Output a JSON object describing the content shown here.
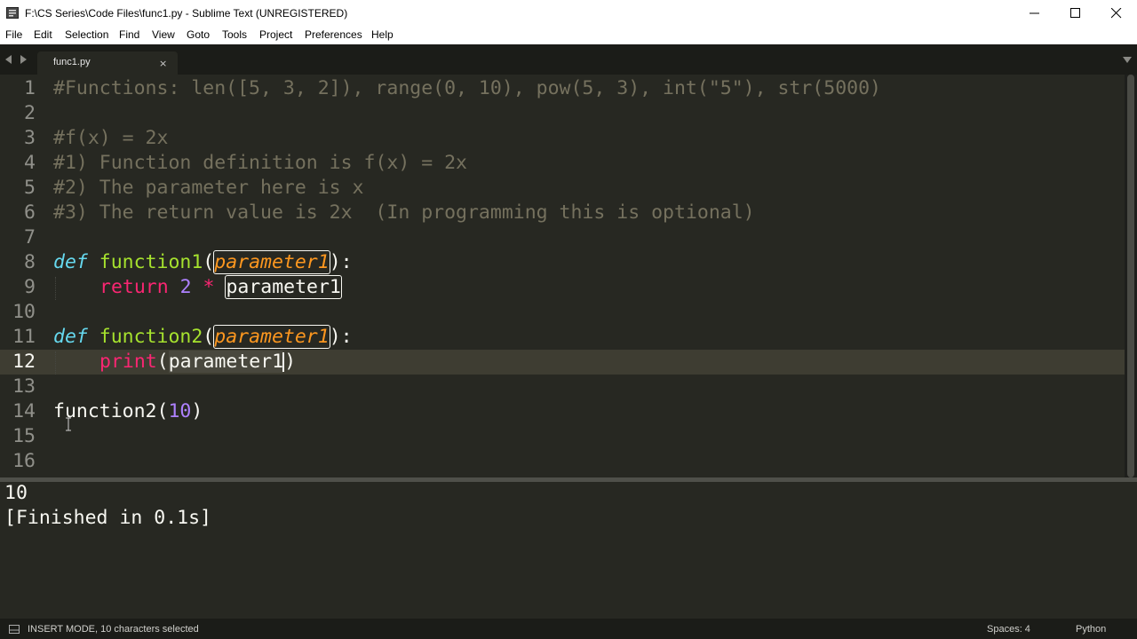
{
  "window": {
    "title": "F:\\CS Series\\Code Files\\func1.py - Sublime Text (UNREGISTERED)",
    "controls": [
      "minimize-icon",
      "maximize-icon",
      "close-icon"
    ]
  },
  "menubar": {
    "items": [
      "File",
      "Edit",
      "Selection",
      "Find",
      "View",
      "Goto",
      "Tools",
      "Project",
      "Preferences",
      "Help"
    ]
  },
  "tabs": {
    "active_tab": "func1.py",
    "close_glyph": "×"
  },
  "editor": {
    "line_numbers": [
      "1",
      "2",
      "3",
      "4",
      "5",
      "6",
      "7",
      "8",
      "9",
      "10",
      "11",
      "12",
      "13",
      "14",
      "15",
      "16"
    ],
    "active_line": 12,
    "code": {
      "l1": "#Functions: len([5, 3, 2]), range(0, 10), pow(5, 3), int(\"5\"), str(5000)",
      "l3": "#f(x) = 2x",
      "l4": "#1) Function definition is f(x) = 2x",
      "l5": "#2) The parameter here is x",
      "l6": "#3) The return value is 2x  (In programming this is optional)",
      "def_kw": "def",
      "function1_name": "function1",
      "function2_name": "function2",
      "param": "parameter1",
      "open_paren": "(",
      "close_colon": "):",
      "return_kw": "return",
      "two": "2",
      "star": "*",
      "print_kw": "print",
      "call_name": "function2",
      "call_arg": "10",
      "close_paren": ")"
    }
  },
  "output": {
    "lines": [
      "10",
      "[Finished in 0.1s]"
    ]
  },
  "statusbar": {
    "mode": "INSERT MODE, 10 characters selected",
    "spaces": "Spaces: 4",
    "syntax": "Python"
  },
  "colors": {
    "background": "#272822",
    "comment": "#75715e",
    "keyword": "#66d9ef",
    "function": "#a6e22e",
    "parameter": "#fd971f",
    "return": "#f92672",
    "number": "#ae81ff"
  }
}
